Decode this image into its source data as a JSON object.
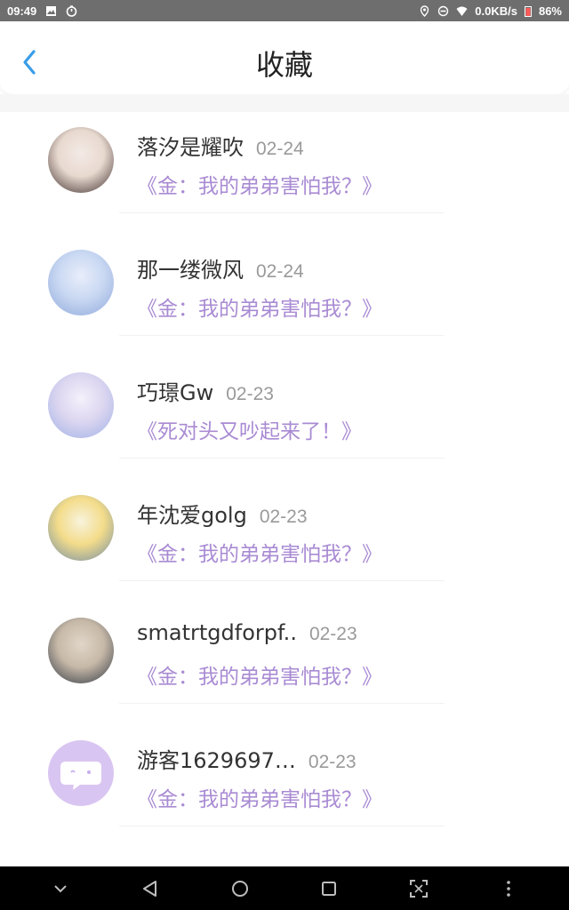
{
  "status_bar": {
    "time": "09:49",
    "network_speed": "0.0KB/s",
    "battery": "86%",
    "icons": [
      "gallery-icon",
      "timer-icon",
      "location-icon",
      "dnd-icon",
      "wifi-icon",
      "battery-icon"
    ]
  },
  "header": {
    "title": "收藏",
    "back_icon": "chevron-left-icon"
  },
  "favorites": [
    {
      "name": "落汐是耀吹",
      "date": "02-24",
      "title": "《金：我的弟弟害怕我？》",
      "avatar_colors": [
        "#e8d9cf",
        "#3b2a2a",
        "#f3eae6"
      ]
    },
    {
      "name": "那一缕微风",
      "date": "02-24",
      "title": "《金：我的弟弟害怕我？》",
      "avatar_colors": [
        "#c9d8f2",
        "#8fa9dc",
        "#e9eefb"
      ]
    },
    {
      "name": "巧璟Gw",
      "date": "02-23",
      "title": "《死对头又吵起来了！》",
      "avatar_colors": [
        "#dcd6f0",
        "#9fb1e6",
        "#f4f1fb"
      ]
    },
    {
      "name": "年沈爱golg",
      "date": "02-23",
      "title": "《金：我的弟弟害怕我？》",
      "avatar_colors": [
        "#f3dc8a",
        "#6f8ba6",
        "#f8f3dd"
      ]
    },
    {
      "name": "smatrtgdforpf..",
      "date": "02-23",
      "title": "《金：我的弟弟害怕我？》",
      "avatar_colors": [
        "#c7b9a8",
        "#2c3440",
        "#e0d6c8"
      ]
    },
    {
      "name": "游客1629697…",
      "date": "02-23",
      "title": "《金：我的弟弟害怕我？》",
      "avatar_colors": [
        "#d9c5f1",
        "#ffffff",
        "#c8aef0"
      ]
    }
  ],
  "nav_bar": {
    "buttons": [
      "chevron-down-icon",
      "back-triangle-icon",
      "home-circle-icon",
      "recents-square-icon",
      "scan-icon",
      "more-vertical-icon"
    ]
  }
}
